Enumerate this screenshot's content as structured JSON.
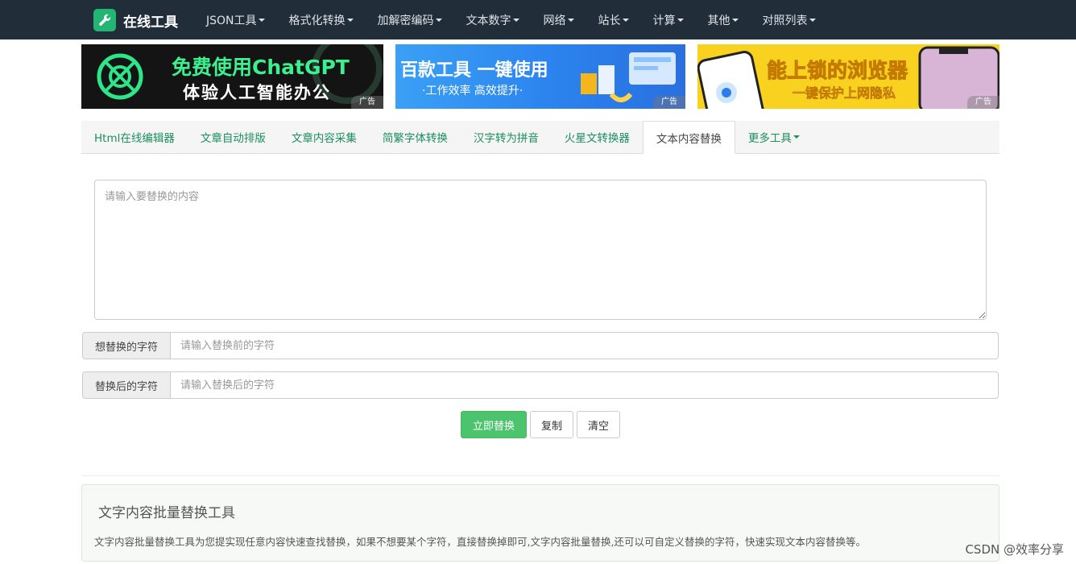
{
  "navbar": {
    "brand": "在线工具",
    "items": [
      {
        "label": "JSON工具",
        "dropdown": true
      },
      {
        "label": "格式化转换",
        "dropdown": true
      },
      {
        "label": "加解密编码",
        "dropdown": true
      },
      {
        "label": "文本数字",
        "dropdown": true
      },
      {
        "label": "网络",
        "dropdown": true
      },
      {
        "label": "站长",
        "dropdown": true
      },
      {
        "label": "计算",
        "dropdown": true
      },
      {
        "label": "其他",
        "dropdown": true
      },
      {
        "label": "对照列表",
        "dropdown": true
      }
    ]
  },
  "ads": [
    {
      "headline": "免费使用ChatGPT",
      "subline": "体验人工智能办公",
      "badge": "广告"
    },
    {
      "headline": "百款工具 一键使用",
      "subline": "·工作效率 高效提升·",
      "badge": "广告"
    },
    {
      "headline": "能上锁的浏览器",
      "subline": "一键保护上网隐私",
      "badge": "广告"
    }
  ],
  "tabs": [
    {
      "label": "Html在线编辑器",
      "active": false
    },
    {
      "label": "文章自动排版",
      "active": false
    },
    {
      "label": "文章内容采集",
      "active": false
    },
    {
      "label": "简繁字体转换",
      "active": false
    },
    {
      "label": "汉字转为拼音",
      "active": false
    },
    {
      "label": "火星文转换器",
      "active": false
    },
    {
      "label": "文本内容替换",
      "active": true
    },
    {
      "label": "更多工具",
      "active": false,
      "dropdown": true
    }
  ],
  "form": {
    "content_placeholder": "请输入要替换的内容",
    "content_value": "",
    "from_label": "想替换的字符",
    "from_placeholder": "请输入替换前的字符",
    "to_label": "替换后的字符",
    "to_placeholder": "请输入替换后的字符"
  },
  "buttons": {
    "replace": "立即替换",
    "copy": "复制",
    "clear": "清空"
  },
  "info": {
    "title": "文字内容批量替换工具",
    "description": "文字内容批量替换工具为您提实现任意内容快速查找替换，如果不想要某个字符，直接替换掉即可,文字内容批量替换,还可以可自定义替换的字符，快速实现文本内容替换等。"
  },
  "watermark": "CSDN @效率分享",
  "colors": {
    "navbar_bg": "#222d3a",
    "brand_icon": "#22b573",
    "tab_link": "#1a8f5f",
    "primary_button": "#4cc36d"
  }
}
